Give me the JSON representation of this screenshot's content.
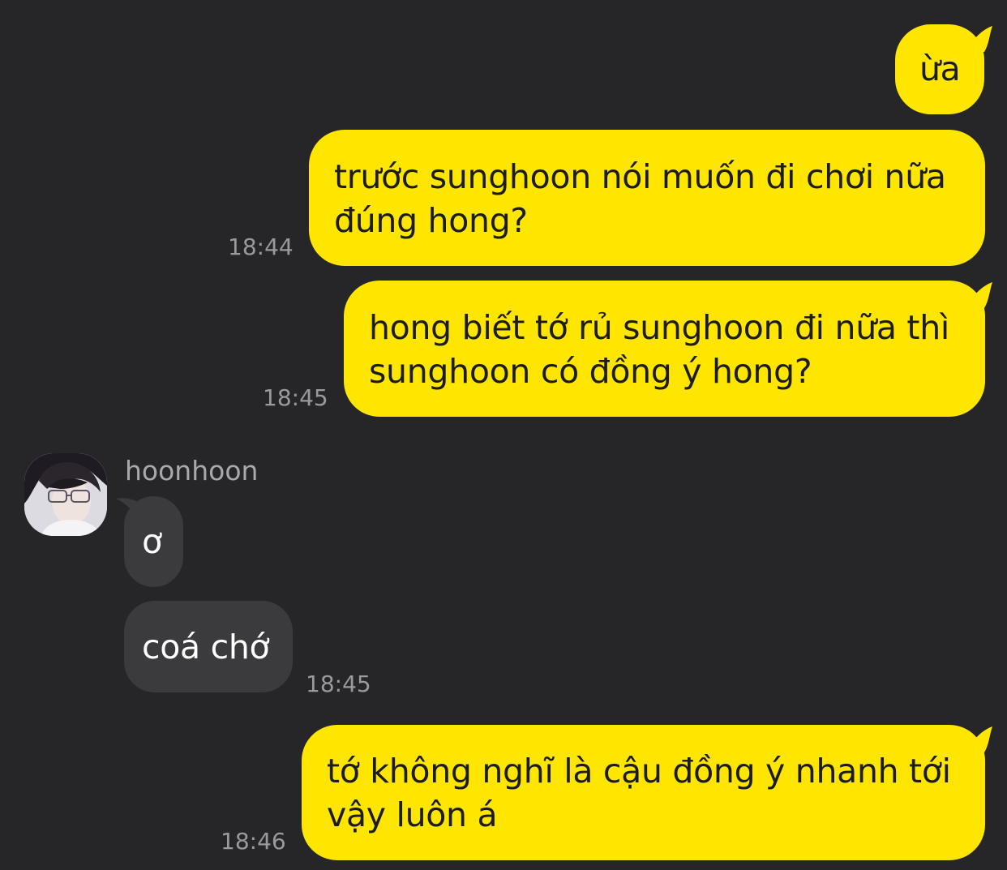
{
  "messages": [
    {
      "from": "me",
      "text": "ừa",
      "time": ""
    },
    {
      "from": "me",
      "lines": [
        "trước sunghoon nói muốn đi chơi nữa",
        "đúng hong?"
      ],
      "time": "18:44"
    },
    {
      "from": "me",
      "lines": [
        "hong biết tớ rủ sunghoon đi nữa thì",
        "sunghoon có đồng ý hong?"
      ],
      "time": "18:45"
    },
    {
      "from": "them",
      "sender": "hoonhoon",
      "text": "ơ"
    },
    {
      "from": "them",
      "text": "coá chớ",
      "time": "18:45"
    },
    {
      "from": "me",
      "lines": [
        "tớ không nghĩ là cậu đồng ý nhanh tới",
        "vậy luôn á"
      ],
      "time": "18:46"
    }
  ],
  "colors": {
    "background": "#262628",
    "my_bubble": "#ffe600",
    "their_bubble": "#3b3b3d",
    "timestamp": "#9a9a9c"
  },
  "avatar_icon": "profile-photo"
}
